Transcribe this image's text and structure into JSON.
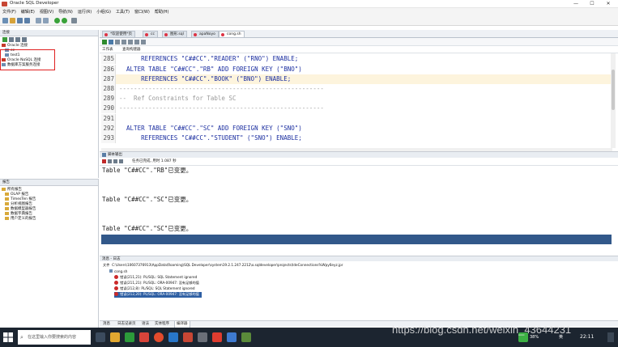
{
  "window": {
    "title": "Oracle SQL Developer",
    "minimize": "—",
    "maximize": "☐",
    "close": "✕"
  },
  "menu": [
    "文件(F)",
    "编辑(E)",
    "视图(V)",
    "导航(N)",
    "运行(R)",
    "小组(G)",
    "工具(T)",
    "窗口(W)",
    "帮助(H)"
  ],
  "connections": {
    "header": "连接",
    "items": [
      "Oracle 连接",
      "cc",
      "test1",
      "Oracle NoSQL 连接",
      "数据库方案服务连接"
    ]
  },
  "reports": {
    "header": "报告",
    "items": [
      "所有报告",
      "OLAP 报告",
      "TimesTen 报告",
      "分析视图报告",
      "数据模型器报告",
      "数据字典报告",
      "用户定义的报告"
    ]
  },
  "tabs": [
    "*欢迎使用*页",
    "cc",
    "图形.sql",
    "apaNoyo",
    "cong.sh"
  ],
  "subtabs": [
    "工作表",
    "查询构建器"
  ],
  "editor": {
    "lines": [
      {
        "n": "285",
        "text": "      REFERENCES \"C##CC\".\"READER\" (\"RNO\") ENABLE;"
      },
      {
        "n": "286",
        "text": "  ALTER TABLE \"C##CC\".\"RB\" ADD FOREIGN KEY (\"BNO\")"
      },
      {
        "n": "287",
        "text": "      REFERENCES \"C##CC\".\"BOOK\" (\"BNO\") ENABLE;"
      },
      {
        "n": "288",
        "text": "--------------------------------------------------------"
      },
      {
        "n": "289",
        "text": "--  Ref Constraints for Table SC"
      },
      {
        "n": "290",
        "text": "--------------------------------------------------------"
      },
      {
        "n": "291",
        "text": ""
      },
      {
        "n": "292",
        "text": "  ALTER TABLE \"C##CC\".\"SC\" ADD FOREIGN KEY (\"SNO\")"
      },
      {
        "n": "293",
        "text": "      REFERENCES \"C##CC\".\"STUDENT\" (\"SNO\") ENABLE;"
      }
    ]
  },
  "script_output": {
    "tab_label": "脚本输出",
    "status": "任务已完成, 用时 1.087 秒",
    "lines": [
      "Table \"C##CC\".\"RB\"已变更。",
      "Table \"C##CC\".\"SC\"已变更。",
      "Table \"C##CC\".\"SC\"已变更。"
    ]
  },
  "log": {
    "header": "消息 - 日志",
    "path_label": "文件",
    "path": "C:\\Users\\10607376913\\AppData\\Roaming\\SQL Developer\\system19.2.1.247.2212\\o.sqldeveloper\\projects\\IdeConnections%Wpy6eyz.jpr",
    "group": "cong.sh",
    "entries": [
      "错误(211,21): PL/SQL: SQL Statement ignored",
      "错误(211,21): PL/SQL: ORA-00947: 没有足够的值",
      "错误(212,8): PL/SQL: SQL Statement ignored",
      "错误(212,20): PL/SQL: ORA-00947: 没有足够的值"
    ],
    "tabs": [
      "消息",
      "日志记录页",
      "语法",
      "实体程序",
      "编译器"
    ]
  },
  "taskbar": {
    "search": "在这里输入你要搜索的内容",
    "battery": "38%",
    "ime": "英",
    "time": "22:11"
  },
  "watermark": "https://blog.csdn.net/weixin_43644231"
}
